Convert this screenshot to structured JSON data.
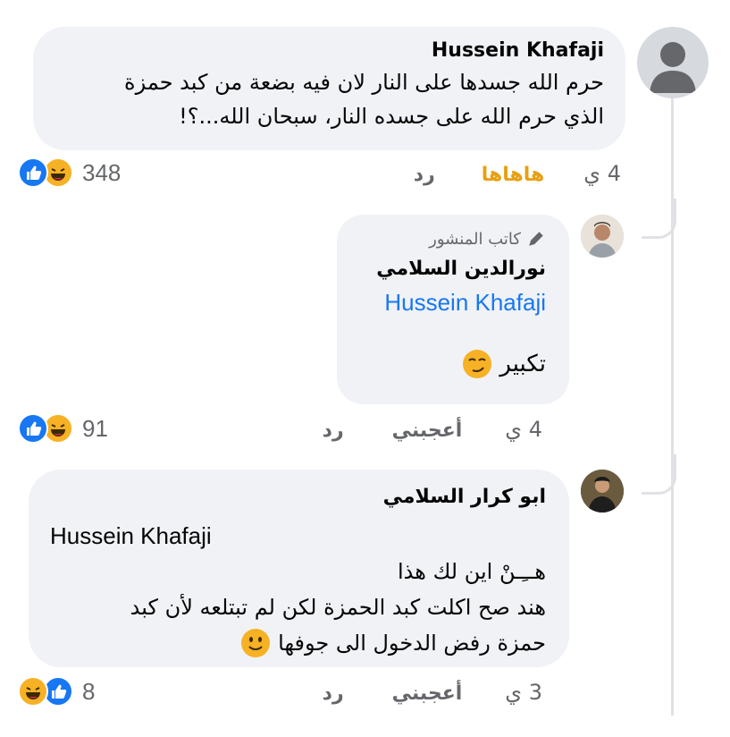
{
  "comments": [
    {
      "author": "Hussein Khafaji",
      "text_lines": [
        "حرم الله جسدها على النار لان فيه بضعة من كبد حمزة",
        "الذي حرم الله على جسده النار، سبحان الله...؟!"
      ],
      "time": "4 ي",
      "reaction_action": "هاهاها",
      "reply_label": "رد",
      "reaction_count": "348",
      "reactions": [
        "like",
        "haha"
      ]
    },
    {
      "badge": "كاتب المنشور",
      "author": "نورالدين السلامي",
      "mention": "Hussein Khafaji",
      "text": "تكبير",
      "emoji": "smirk-emoji",
      "time": "4 ي",
      "like_label": "أعجبني",
      "reply_label": "رد",
      "reaction_count": "91",
      "reactions": [
        "like",
        "haha"
      ]
    },
    {
      "author": "ابو كرار السلامي",
      "mention": "Hussein Khafaji",
      "text_lines": [
        "هــِـنْ اين لك هذا",
        "هند صح اكلت كبد الحمزة لكن لم تبتلعه لأن كبد",
        "حمزة رفض الدخول الى جوفها"
      ],
      "emoji": "slight-smile-emoji",
      "time": "3 ي",
      "like_label": "أعجبني",
      "reply_label": "رد",
      "reaction_count": "8",
      "reactions": [
        "haha",
        "like"
      ]
    }
  ],
  "colors": {
    "like": "#1877f2",
    "haha": "#f7b125",
    "action_active": "#e7a012",
    "link": "#1877f2"
  }
}
